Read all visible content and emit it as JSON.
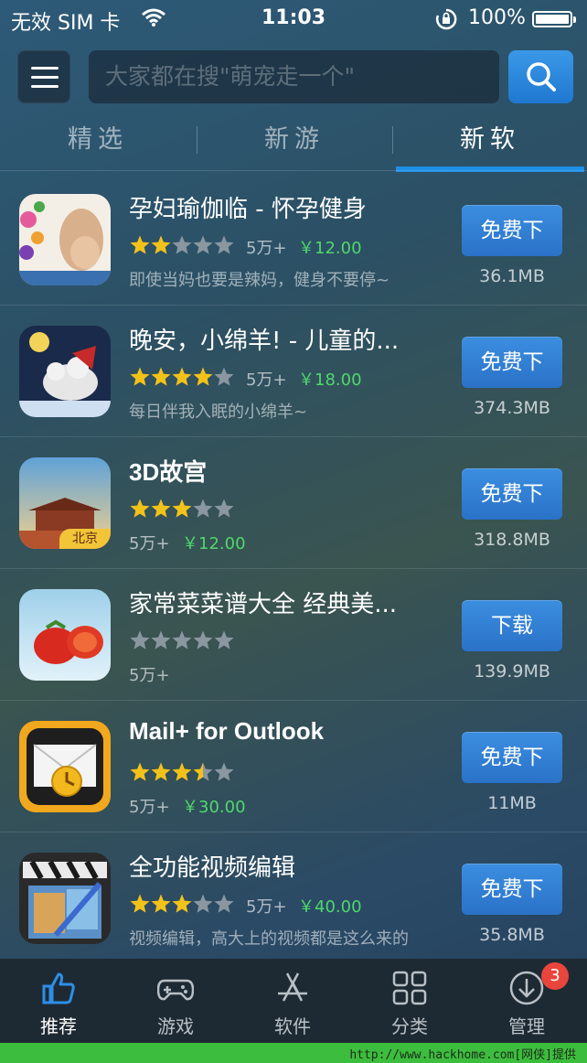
{
  "status_bar": {
    "carrier": "无效 SIM 卡",
    "time": "11:03",
    "battery": "100%"
  },
  "search": {
    "placeholder": "大家都在搜\"萌宠走一个\""
  },
  "tabs": [
    {
      "label": "精选",
      "active": false
    },
    {
      "label": "新游",
      "active": false
    },
    {
      "label": "新软",
      "active": true
    }
  ],
  "apps": [
    {
      "name": "孕妇瑜伽临 - 怀孕健身",
      "rating": 2,
      "downloads": "5万+",
      "price": "￥12.00",
      "desc": "即使当妈也要是辣妈，健身不要停~",
      "button": "免费下",
      "size": "36.1MB"
    },
    {
      "name": "晚安，小绵羊! - 儿童的...",
      "rating": 4,
      "downloads": "5万+",
      "price": "￥18.00",
      "desc": "每日伴我入眠的小绵羊~",
      "button": "免费下",
      "size": "374.3MB"
    },
    {
      "name": "3D故宫",
      "rating": 3,
      "downloads": "5万+",
      "price": "￥12.00",
      "desc": "",
      "button": "免费下",
      "size": "318.8MB",
      "icon_label": "北京"
    },
    {
      "name": "家常菜菜谱大全 经典美...",
      "rating": 0,
      "downloads": "5万+",
      "price": "",
      "desc": "",
      "button": "下载",
      "size": "139.9MB"
    },
    {
      "name": "Mail+ for Outlook",
      "rating": 3.5,
      "downloads": "5万+",
      "price": "￥30.00",
      "desc": "",
      "button": "免费下",
      "size": "11MB"
    },
    {
      "name": "全功能视频编辑",
      "rating": 3,
      "downloads": "5万+",
      "price": "￥40.00",
      "desc": "视频编辑，高大上的视频都是这么来的",
      "button": "免费下",
      "size": "35.8MB"
    }
  ],
  "tab_bar": [
    {
      "label": "推荐",
      "icon": "thumbs-up-icon",
      "active": true
    },
    {
      "label": "游戏",
      "icon": "gamepad-icon",
      "active": false
    },
    {
      "label": "软件",
      "icon": "app-store-icon",
      "active": false
    },
    {
      "label": "分类",
      "icon": "grid-icon",
      "active": false
    },
    {
      "label": "管理",
      "icon": "download-icon",
      "active": false
    }
  ],
  "badge": "3",
  "watermark": "http://www.hackhome.com[网侠]提供",
  "colors": {
    "accent": "#1e8fe6",
    "price": "#4fd86a",
    "star": "#f2c21a",
    "badge": "#e8453c"
  }
}
